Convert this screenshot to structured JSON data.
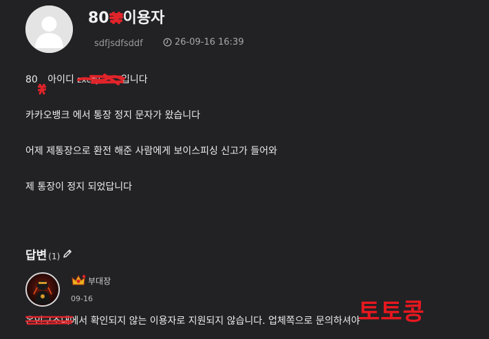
{
  "post": {
    "title_prefix": "80",
    "title_suffix": "이용자",
    "author": "sdfjsdfsddf",
    "date": "26-09-16 16:39",
    "clock_icon": "clock-icon"
  },
  "body": {
    "line1_prefix": "80",
    "line1_label": "아이디",
    "line1_id_fragment": "zxczy",
    "line1_suffix": "입니다",
    "line2": "카카오뱅크 에서 통장 정지 문자가 왔습니다",
    "line3": "어제 제통장으로 환전 해준 사람에게  보이스피싱 신고가 들어와",
    "line4": "제 통장이 정지 되었답니다"
  },
  "answers": {
    "title": "답변",
    "count": "(1)",
    "reply": {
      "rank": "부대장",
      "date": "09-16",
      "text_prefix": "온인구조대",
      "text": "에서 확인되지 않는 이용자로 지원되지 않습니다. 업체쪽으로 문의하셔야"
    }
  },
  "watermark": "토토콩",
  "colors": {
    "background": "#222225",
    "redaction": "#e0242a",
    "watermark": "#e8181f"
  }
}
